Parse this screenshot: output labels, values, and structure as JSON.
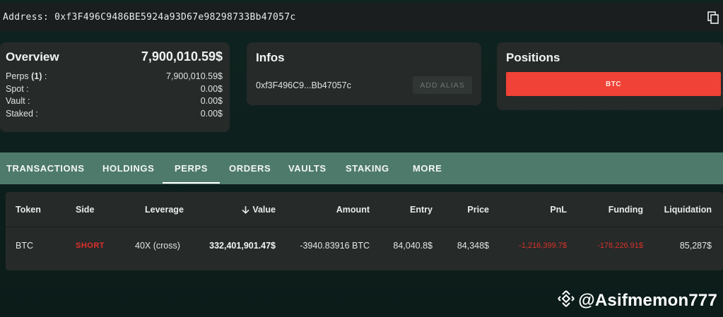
{
  "address_bar": {
    "label": "Address:",
    "value": "0xf3F496C9486BE5924a93D67e98298733Bb47057c",
    "copy_icon": "copy-icon"
  },
  "overview": {
    "title": "Overview",
    "total": "7,900,010.59$",
    "rows": [
      {
        "label": "Perps",
        "count": "(1)",
        "suffix": " :",
        "value": "7,900,010.59$"
      },
      {
        "label": "Spot :",
        "value": "0.00$"
      },
      {
        "label": "Vault :",
        "value": "0.00$"
      },
      {
        "label": "Staked :",
        "value": "0.00$"
      }
    ]
  },
  "infos": {
    "title": "Infos",
    "short_address": "0xf3F496C9...Bb47057c",
    "alias_button": "ADD ALIAS"
  },
  "positions": {
    "title": "Positions",
    "bar_label": "BTC",
    "bar_color": "#f04236"
  },
  "tabs": [
    {
      "label": "TRANSACTIONS",
      "active": false
    },
    {
      "label": "HOLDINGS",
      "active": false
    },
    {
      "label": "PERPS",
      "active": true
    },
    {
      "label": "ORDERS",
      "active": false
    },
    {
      "label": "VAULTS",
      "active": false
    },
    {
      "label": "STAKING",
      "active": false
    },
    {
      "label": "MORE",
      "active": false
    }
  ],
  "table": {
    "headers": [
      "Token",
      "Side",
      "Leverage",
      "Value",
      "Amount",
      "Entry",
      "Price",
      "PnL",
      "Funding",
      "Liquidation"
    ],
    "sort_icon": "arrow-down-icon",
    "rows": [
      {
        "token": "BTC",
        "side": "SHORT",
        "leverage": "40X (cross)",
        "value": "332,401,901.47$",
        "amount": "-3940.83916 BTC",
        "entry": "84,040.8$",
        "price": "84,348$",
        "pnl": "-1,216,399.7$",
        "funding": "-178,226.91$",
        "liquidation": "85,287$"
      }
    ]
  },
  "colors": {
    "accent_tab_bar": "#4e7a6c",
    "negative": "#d8322a",
    "card_bg": "#262a29"
  },
  "watermark": {
    "icon": "binance-logo-icon",
    "text": "@Asifmemon777"
  }
}
